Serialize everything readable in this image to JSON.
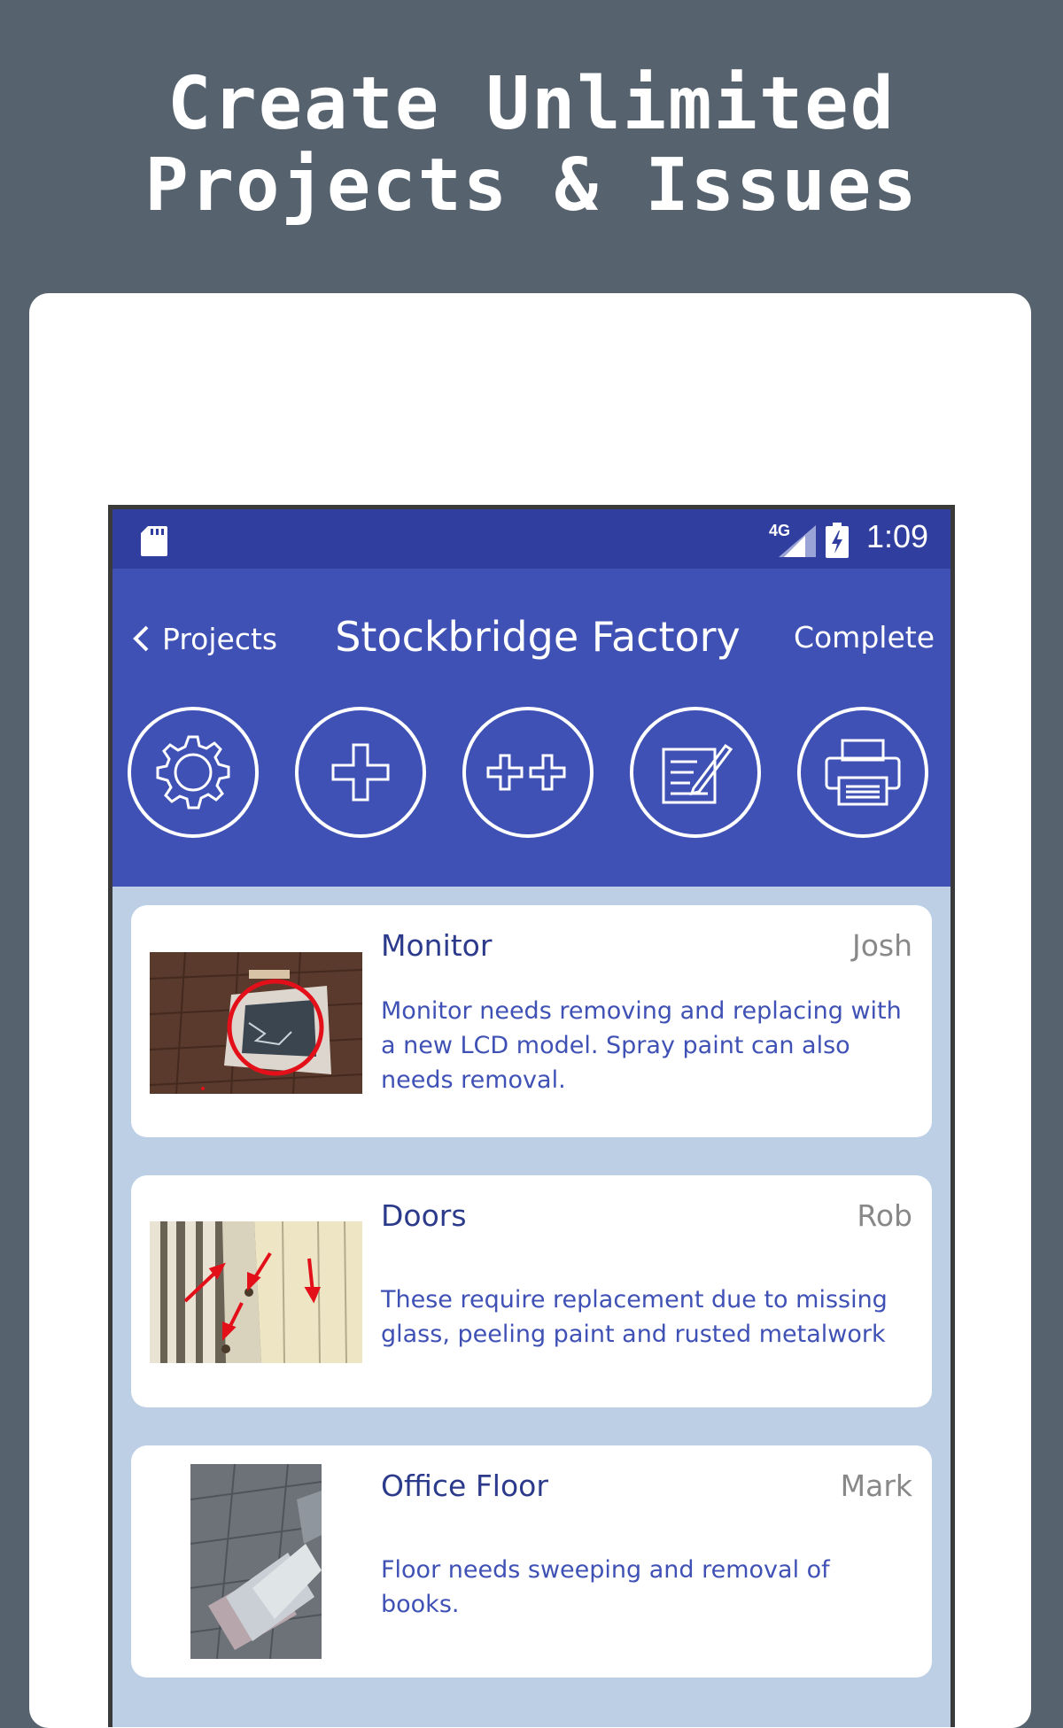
{
  "headline": {
    "line1": "Create Unlimited",
    "line2": "Projects & Issues"
  },
  "status_bar": {
    "network": "4G",
    "time": "1:09"
  },
  "toolbar": {
    "back_label": "Projects",
    "title": "Stockbridge Factory",
    "complete_label": "Complete"
  },
  "actions": [
    {
      "name": "settings",
      "icon": "gear-icon"
    },
    {
      "name": "add-issue",
      "icon": "plus-icon"
    },
    {
      "name": "add-multiple-issues",
      "icon": "double-plus-icon"
    },
    {
      "name": "edit-notes",
      "icon": "notepad-pen-icon"
    },
    {
      "name": "print",
      "icon": "printer-icon"
    }
  ],
  "issues": [
    {
      "title": "Monitor",
      "assignee": "Josh",
      "description": "Monitor needs removing and replacing with a new LCD model. Spray paint can also needs removal."
    },
    {
      "title": "Doors",
      "assignee": "Rob",
      "description": "These require replacement due to missing glass, peeling paint and rusted metalwork"
    },
    {
      "title": "Office Floor",
      "assignee": "Mark",
      "description": "Floor needs sweeping and removal of books."
    }
  ],
  "colors": {
    "background": "#56636f",
    "status_bar": "#303f9f",
    "toolbar": "#3f51b5",
    "list_background": "#bccfe4",
    "title_text": "#2c3a8c",
    "annotation": "#e3101a"
  }
}
